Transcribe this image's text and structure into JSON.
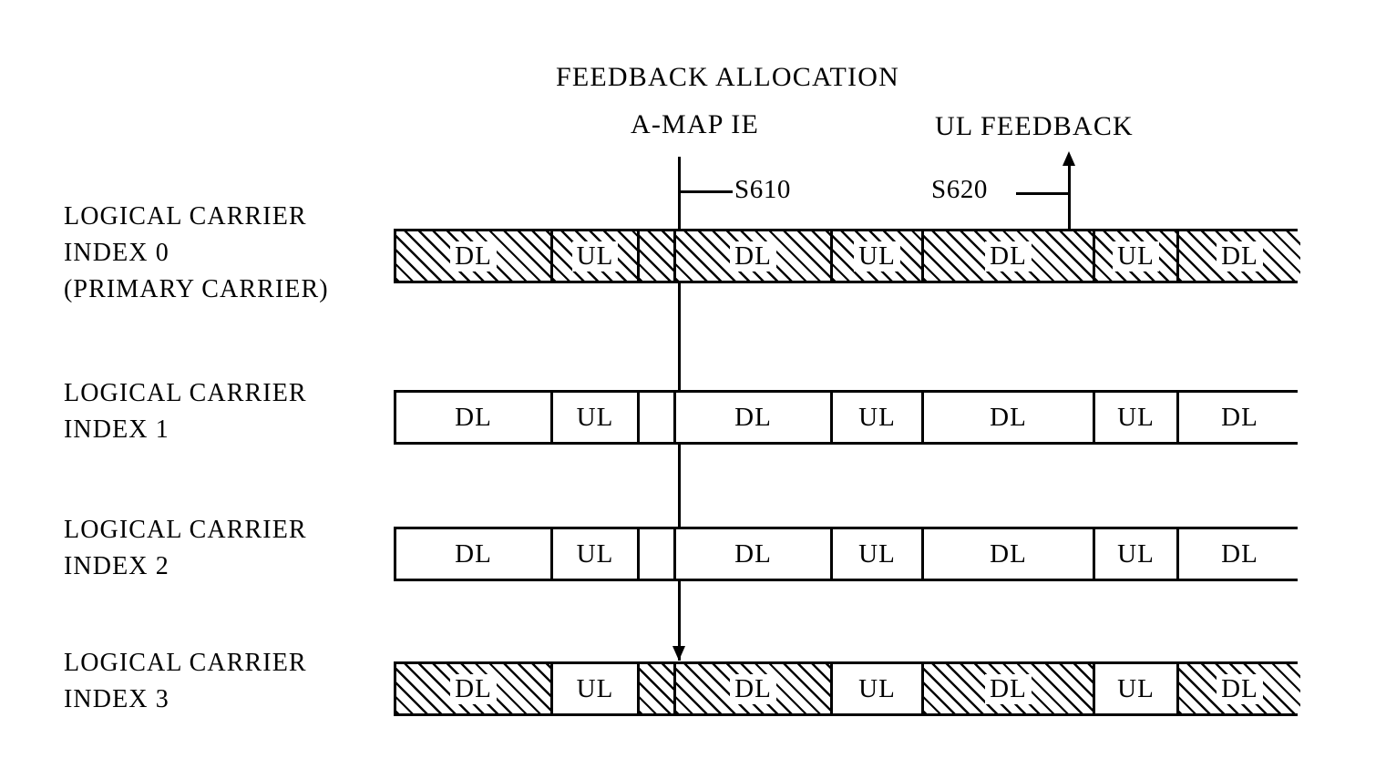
{
  "figure": {
    "headers": {
      "feedback_allocation": "FEEDBACK ALLOCATION",
      "a_map_ie": "A-MAP IE",
      "ul_feedback": "UL FEEDBACK"
    },
    "references": {
      "s610": "S610",
      "s620": "S620"
    },
    "rows": [
      {
        "label": "LOGICAL CARRIER\nINDEX 0\n(PRIMARY CARRIER)",
        "hatch_mode": "all",
        "cells": [
          {
            "label": "DL",
            "hatched": true
          },
          {
            "label": "UL",
            "hatched": true
          },
          {
            "label": "",
            "hatched": true
          },
          {
            "label": "DL",
            "hatched": true
          },
          {
            "label": "UL",
            "hatched": true
          },
          {
            "label": "DL",
            "hatched": true
          },
          {
            "label": "UL",
            "hatched": true
          },
          {
            "label": "DL",
            "hatched": true
          }
        ]
      },
      {
        "label": "LOGICAL CARRIER\nINDEX 1",
        "hatch_mode": "none",
        "cells": [
          {
            "label": "DL",
            "hatched": false
          },
          {
            "label": "UL",
            "hatched": false
          },
          {
            "label": "",
            "hatched": false
          },
          {
            "label": "DL",
            "hatched": false
          },
          {
            "label": "UL",
            "hatched": false
          },
          {
            "label": "DL",
            "hatched": false
          },
          {
            "label": "UL",
            "hatched": false
          },
          {
            "label": "DL",
            "hatched": false
          }
        ]
      },
      {
        "label": "LOGICAL CARRIER\nINDEX 2",
        "hatch_mode": "none",
        "cells": [
          {
            "label": "DL",
            "hatched": false
          },
          {
            "label": "UL",
            "hatched": false
          },
          {
            "label": "",
            "hatched": false
          },
          {
            "label": "DL",
            "hatched": false
          },
          {
            "label": "UL",
            "hatched": false
          },
          {
            "label": "DL",
            "hatched": false
          },
          {
            "label": "UL",
            "hatched": false
          },
          {
            "label": "DL",
            "hatched": false
          }
        ]
      },
      {
        "label": "LOGICAL CARRIER\nINDEX 3",
        "hatch_mode": "dl-only",
        "cells": [
          {
            "label": "DL",
            "hatched": true
          },
          {
            "label": "UL",
            "hatched": false
          },
          {
            "label": "",
            "hatched": true
          },
          {
            "label": "DL",
            "hatched": true
          },
          {
            "label": "UL",
            "hatched": false
          },
          {
            "label": "DL",
            "hatched": true
          },
          {
            "label": "UL",
            "hatched": false
          },
          {
            "label": "DL",
            "hatched": true
          }
        ]
      }
    ],
    "colors": {
      "ink": "#000000",
      "paper": "#ffffff"
    }
  }
}
